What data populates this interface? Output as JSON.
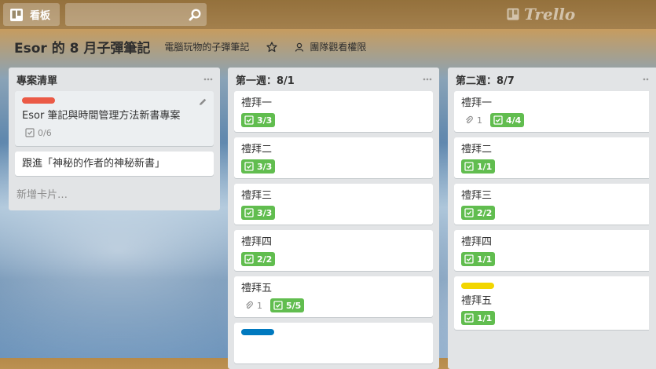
{
  "topbar": {
    "boards_label": "看板",
    "logo_text": "Trello"
  },
  "board": {
    "title": "Esor 的 8 月子彈筆記",
    "team": "電腦玩物的子彈筆記",
    "visibility": "團隊觀看權限"
  },
  "lists": [
    {
      "title": "專案清單",
      "add_card": "新增卡片…",
      "cards": [
        {
          "title": "Esor 筆記與時間管理方法新書專案",
          "label_color": "#eb5a46",
          "checklist": "0/6",
          "checklist_done": false
        },
        {
          "title": "跟進「神秘的作者的神秘新書」"
        }
      ]
    },
    {
      "title": "第一週：8/1",
      "cards": [
        {
          "title": "禮拜一",
          "checklist": "3/3"
        },
        {
          "title": "禮拜二",
          "checklist": "3/3"
        },
        {
          "title": "禮拜三",
          "checklist": "3/3"
        },
        {
          "title": "禮拜四",
          "checklist": "2/2"
        },
        {
          "title": "禮拜五",
          "attachments": "1",
          "checklist": "5/5"
        },
        {
          "label_color": "#0079bf"
        }
      ]
    },
    {
      "title": "第二週：8/7",
      "cards": [
        {
          "title": "禮拜一",
          "attachments": "1",
          "checklist": "4/4"
        },
        {
          "title": "禮拜二",
          "checklist": "1/1"
        },
        {
          "title": "禮拜三",
          "checklist": "2/2"
        },
        {
          "title": "禮拜四",
          "checklist": "1/1"
        },
        {
          "title": "禮拜五",
          "label_color": "#f2d600",
          "checklist": "1/1"
        }
      ]
    }
  ],
  "colors": {
    "checklist_complete": "#61bd4f",
    "list_bg": "#e2e4e6"
  }
}
